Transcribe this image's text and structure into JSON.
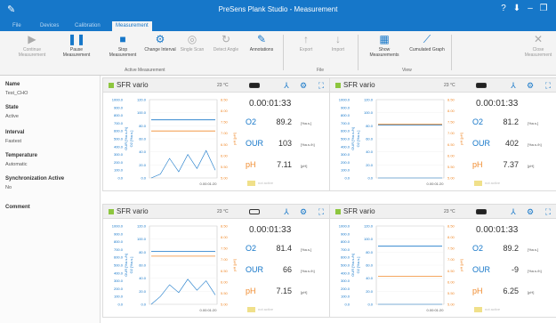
{
  "app": {
    "title": "PreSens Plank Studio - Measurement",
    "tabs": [
      "File",
      "Devices",
      "Calibration",
      "Measurement"
    ]
  },
  "ribbon": {
    "buttons": [
      {
        "label": "Continue Measurement",
        "icon": "play-icon",
        "enabled": false
      },
      {
        "label": "Pause Measurement",
        "icon": "pause-icon",
        "enabled": true
      },
      {
        "label": "Stop Measurement",
        "icon": "stop-icon",
        "enabled": true
      },
      {
        "label": "Change Interval",
        "icon": "gear-icon",
        "enabled": true
      },
      {
        "label": "Single Scan",
        "icon": "scan-icon",
        "enabled": false
      },
      {
        "label": "Detect Angle",
        "icon": "refresh-icon",
        "enabled": false
      },
      {
        "label": "Annotations",
        "icon": "pencil-icon",
        "enabled": true
      },
      {
        "label": "Export",
        "icon": "export-icon",
        "enabled": false
      },
      {
        "label": "Import",
        "icon": "import-icon",
        "enabled": false
      },
      {
        "label": "Show Measurements",
        "icon": "table-icon",
        "enabled": true
      },
      {
        "label": "Cumulated Graph",
        "icon": "graph-icon",
        "enabled": true
      },
      {
        "label": "Close Measurement",
        "icon": "close-icon",
        "enabled": false
      }
    ],
    "groups": [
      "Active Measurement",
      "File",
      "View"
    ]
  },
  "properties": [
    {
      "name": "Name",
      "value": "Test_CHO"
    },
    {
      "name": "State",
      "value": "Active"
    },
    {
      "name": "Interval",
      "value": "Fastest"
    },
    {
      "name": "Temperature",
      "value": "Automatic"
    },
    {
      "name": "Synchronization Active",
      "value": "No"
    },
    {
      "name": "Comment",
      "value": ""
    }
  ],
  "chart_legend": {
    "our_axis": "OUR [%a.s./h]",
    "o2_axis": "O2 [%a.s.]",
    "ph_axis": "pH [pH]",
    "our_ticks": [
      "1000.0",
      "900.0",
      "800.0",
      "700.0",
      "600.0",
      "500.0",
      "400.0",
      "300.0",
      "200.0",
      "100.0",
      "0.0"
    ],
    "o2_ticks": [
      "120.0",
      "100.0",
      "80.0",
      "60.0",
      "40.0",
      "20.0",
      "0.0"
    ],
    "ph_ticks": [
      "8.50",
      "8.00",
      "7.50",
      "7.00",
      "6.50",
      "6.00",
      "5.50",
      "5.00"
    ],
    "time_label": "0.00:01:20",
    "colors": {
      "our": "#1677c9",
      "o2": "#1677c9",
      "ph": "#f08a2c",
      "accent": "#8dc63f"
    }
  },
  "panels": [
    {
      "name": "SFR vario",
      "temp": "23 °C",
      "time": "0.00:01:33",
      "o2": "89.2",
      "o2_unit": "[%a.s.]",
      "our": "103",
      "our_unit": "[%a.s./h]",
      "ph": "7.11",
      "ph_unit": "[pH]",
      "indicator": "not active",
      "toggle_on": true,
      "chart_data": {
        "type": "line",
        "x_label": "0.00:01:20",
        "ylim_o2": [
          0,
          120
        ],
        "ylim_our": [
          0,
          1000
        ],
        "ylim_ph": [
          5.0,
          8.5
        ],
        "series": [
          {
            "values": [
              89,
              89,
              89,
              89,
              89,
              89,
              89,
              89
            ]
          },
          {
            "values": [
              7.1,
              7.1,
              7.1,
              7.1,
              7.1,
              7.1,
              7.1,
              7.1
            ]
          },
          {
            "values": [
              0,
              50,
              250,
              80,
              300,
              120,
              350,
              100
            ]
          }
        ]
      }
    },
    {
      "name": "SFR vario",
      "temp": "23 °C",
      "time": "0.00:01:33",
      "o2": "81.2",
      "o2_unit": "[%a.s.]",
      "our": "402",
      "our_unit": "[%a.s./h]",
      "ph": "7.37",
      "ph_unit": "[pH]",
      "indicator": "not active",
      "toggle_on": true,
      "chart_data": {
        "type": "line",
        "x_label": "0.00:01:20",
        "ylim_o2": [
          0,
          120
        ],
        "ylim_our": [
          0,
          1000
        ],
        "ylim_ph": [
          5.0,
          8.5
        ],
        "series": [
          {
            "values": [
              81,
              81,
              81,
              81,
              81,
              81,
              81,
              81
            ]
          },
          {
            "values": [
              7.4,
              7.4,
              7.4,
              7.4,
              7.4,
              7.4,
              7.4,
              7.4
            ]
          },
          {
            "values": [
              0,
              0,
              0,
              0,
              0,
              0,
              0,
              0
            ]
          }
        ]
      }
    },
    {
      "name": "SFR vario",
      "temp": "23 °C",
      "time": "0.00:01:33",
      "o2": "81.4",
      "o2_unit": "[%a.s.]",
      "our": "66",
      "our_unit": "[%a.s./h]",
      "ph": "7.15",
      "ph_unit": "[pH]",
      "indicator": "not active",
      "toggle_on": false,
      "chart_data": {
        "type": "line",
        "x_label": "0.00:01:20",
        "ylim_o2": [
          0,
          120
        ],
        "ylim_our": [
          0,
          1000
        ],
        "ylim_ph": [
          5.0,
          8.5
        ],
        "series": [
          {
            "values": [
              81,
              81,
              81,
              81,
              81,
              81,
              81,
              81
            ]
          },
          {
            "values": [
              7.15,
              7.15,
              7.15,
              7.15,
              7.15,
              7.15,
              7.15,
              7.15
            ]
          },
          {
            "values": [
              0,
              100,
              250,
              150,
              320,
              180,
              300,
              120
            ]
          }
        ]
      }
    },
    {
      "name": "SFR vario",
      "temp": "23 °C",
      "time": "0.00:01:33",
      "o2": "89.2",
      "o2_unit": "[%a.s.]",
      "our": "-9",
      "our_unit": "[%a.s./h]",
      "ph": "6.25",
      "ph_unit": "[pH]",
      "indicator": "not active",
      "toggle_on": true,
      "chart_data": {
        "type": "line",
        "x_label": "0.00:01:20",
        "ylim_o2": [
          0,
          120
        ],
        "ylim_our": [
          0,
          1000
        ],
        "ylim_ph": [
          5.0,
          8.5
        ],
        "series": [
          {
            "values": [
              89,
              89,
              89,
              89,
              89,
              89,
              89,
              89
            ]
          },
          {
            "values": [
              6.25,
              6.25,
              6.25,
              6.25,
              6.25,
              6.25,
              6.25,
              6.25
            ]
          },
          {
            "values": [
              0,
              0,
              0,
              0,
              0,
              0,
              0,
              0
            ]
          }
        ]
      }
    }
  ]
}
